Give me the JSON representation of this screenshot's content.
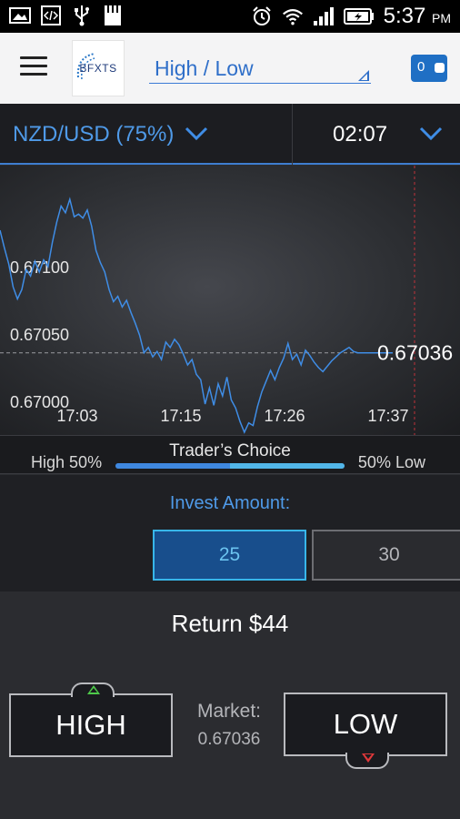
{
  "status_bar": {
    "time": "5:37",
    "ampm": "PM",
    "icons": [
      "image-icon",
      "code-icon",
      "usb-icon",
      "sd-card-icon",
      "alarm-icon",
      "wifi-icon",
      "signal-icon",
      "battery-icon"
    ]
  },
  "header": {
    "logo_text": "BFXTS",
    "mode": "High / Low",
    "wallet_balance": "0"
  },
  "asset": {
    "name": "NZD/USD (75%)",
    "expiry": "02:07"
  },
  "chart_data": {
    "type": "line",
    "y_ticks": [
      "0.67100",
      "0.67050",
      "0.67000"
    ],
    "x_ticks": [
      "17:03",
      "17:15",
      "17:26",
      "17:37"
    ],
    "current_label": "0.67036",
    "current_value": 0.67036,
    "ylim": [
      0.66975,
      0.67175
    ],
    "x": [
      0,
      1,
      2,
      3,
      4,
      5,
      6,
      7,
      8,
      9,
      10,
      11,
      12,
      13,
      14,
      15,
      16,
      17,
      18,
      19,
      20,
      21,
      22,
      23,
      24,
      25,
      26,
      27,
      28,
      29,
      30,
      31,
      32,
      33,
      34,
      35,
      36,
      37,
      38,
      39,
      40,
      41,
      42,
      43,
      44,
      45,
      46,
      47,
      48,
      49,
      50,
      51,
      52,
      53,
      54,
      55,
      56,
      57,
      58,
      59,
      60,
      61,
      62,
      63,
      64,
      65,
      66,
      67,
      68,
      69,
      70,
      71,
      72,
      73,
      74,
      75,
      76,
      77,
      78,
      79,
      80,
      81,
      82,
      83,
      84,
      85,
      86,
      87,
      88,
      89,
      90
    ],
    "values": [
      0.67127,
      0.67114,
      0.67102,
      0.67085,
      0.67076,
      0.67083,
      0.67098,
      0.67093,
      0.67104,
      0.67096,
      0.67105,
      0.671,
      0.67118,
      0.67133,
      0.67145,
      0.6714,
      0.6715,
      0.67137,
      0.67139,
      0.67136,
      0.67142,
      0.6713,
      0.67112,
      0.67103,
      0.67096,
      0.67083,
      0.67074,
      0.67078,
      0.6707,
      0.67075,
      0.67066,
      0.67058,
      0.67049,
      0.67036,
      0.6704,
      0.67033,
      0.67037,
      0.67031,
      0.67044,
      0.6704,
      0.67046,
      0.67042,
      0.67035,
      0.67027,
      0.67031,
      0.6702,
      0.67016,
      0.66998,
      0.6701,
      0.66997,
      0.67013,
      0.67004,
      0.67018,
      0.67001,
      0.66995,
      0.66985,
      0.66977,
      0.66984,
      0.66982,
      0.66996,
      0.67007,
      0.67015,
      0.67023,
      0.67016,
      0.67025,
      0.67032,
      0.67043,
      0.67031,
      0.67035,
      0.67027,
      0.67038,
      0.67034,
      0.67029,
      0.67025,
      0.67022,
      0.67026,
      0.6703,
      0.67033,
      0.67036,
      0.67038,
      0.6704,
      0.67037,
      0.67036,
      0.67036,
      0.67036,
      0.67036,
      0.67036,
      0.67036,
      0.67036,
      0.67036,
      0.67036
    ],
    "line_color": "#3f8de6",
    "grid": false
  },
  "traders_choice": {
    "title": "Trader’s Choice",
    "high_label": "High",
    "high_pct": "50%",
    "low_label": "Low",
    "low_pct": "50%",
    "high_fraction": 0.5
  },
  "invest": {
    "title": "Invest Amount:",
    "amounts": [
      "25",
      "30"
    ],
    "selected": "25"
  },
  "trade": {
    "return_text": "Return $44",
    "high_label": "HIGH",
    "low_label": "LOW",
    "market_label": "Market:",
    "market_value": "0.67036"
  },
  "colors": {
    "accent": "#3f8de6",
    "selected_amount": "#184e8c",
    "high_arrow": "#4ec94a",
    "low_arrow": "#e0383a"
  }
}
